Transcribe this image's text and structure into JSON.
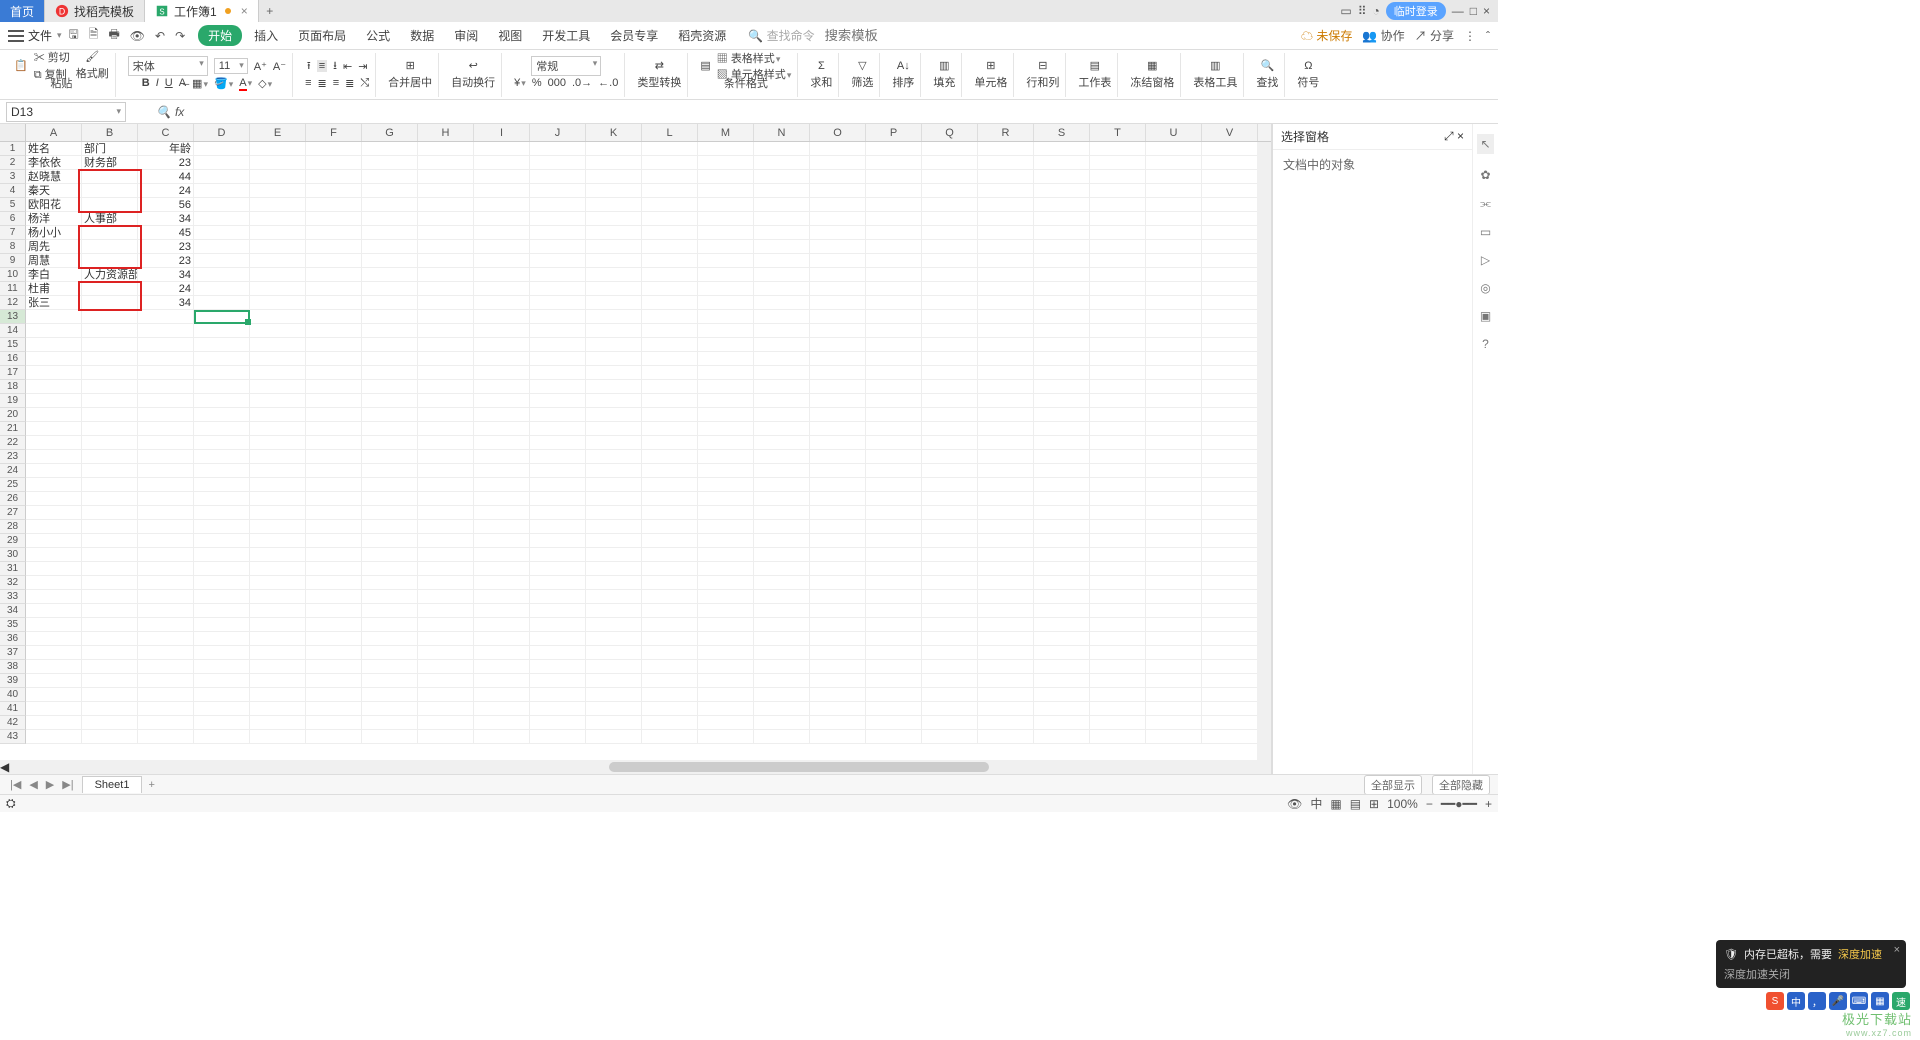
{
  "tabs": {
    "home": "首页",
    "template": "找稻壳模板",
    "workbook": "工作簿1"
  },
  "window": {
    "login": "临时登录"
  },
  "menu": {
    "file": "文件",
    "start": "开始",
    "items": [
      "插入",
      "页面布局",
      "公式",
      "数据",
      "审阅",
      "视图",
      "开发工具",
      "会员专享",
      "稻壳资源"
    ],
    "search_cmd": "查找命令",
    "search_tmpl": "搜索模板",
    "unsaved": "未保存",
    "coop": "协作",
    "share": "分享"
  },
  "ribbon": {
    "paste": "粘贴",
    "cut": "剪切",
    "copy": "复制",
    "format_painter": "格式刷",
    "font_name": "宋体",
    "font_size": "11",
    "merge": "合并居中",
    "wrap": "自动换行",
    "number_format": "常规",
    "type_convert": "类型转换",
    "cond_format": "条件格式",
    "table_style": "表格样式",
    "cell_style": "单元格样式",
    "sum": "求和",
    "filter": "筛选",
    "sort": "排序",
    "fill": "填充",
    "cell": "单元格",
    "rowcol": "行和列",
    "worksheet": "工作表",
    "freeze": "冻结窗格",
    "table_tools": "表格工具",
    "find": "查找",
    "symbol": "符号"
  },
  "namebox": "D13",
  "fx": "fx",
  "columns": [
    "A",
    "B",
    "C",
    "D",
    "E",
    "F",
    "G",
    "H",
    "I",
    "J",
    "K",
    "L",
    "M",
    "N",
    "O",
    "P",
    "Q",
    "R",
    "S",
    "T",
    "U",
    "V"
  ],
  "row_count": 43,
  "selected_row": 13,
  "data_rows": [
    {
      "A": "姓名",
      "B": "部门",
      "C": "年龄"
    },
    {
      "A": "李依依",
      "B": "财务部",
      "C": "23"
    },
    {
      "A": "赵晓慧",
      "B": "",
      "C": "44"
    },
    {
      "A": "秦天",
      "B": "",
      "C": "24"
    },
    {
      "A": "欧阳花",
      "B": "",
      "C": "56"
    },
    {
      "A": "杨洋",
      "B": "人事部",
      "C": "34"
    },
    {
      "A": "杨小小",
      "B": "",
      "C": "45"
    },
    {
      "A": "周先",
      "B": "",
      "C": "23"
    },
    {
      "A": "周慧",
      "B": "",
      "C": "23"
    },
    {
      "A": "李白",
      "B": "人力资源部",
      "C": "34"
    },
    {
      "A": "杜甫",
      "B": "",
      "C": "24"
    },
    {
      "A": "张三",
      "B": "",
      "C": "34"
    }
  ],
  "panel": {
    "title": "选择窗格",
    "subtitle": "文档中的对象"
  },
  "sheet": {
    "name": "Sheet1",
    "show_all": "全部显示",
    "hide_all": "全部隐藏"
  },
  "status": {
    "zoom": "100%"
  },
  "toast": {
    "line1": "内存已超标，需要",
    "accel": "深度加速",
    "line2": "深度加速关闭"
  },
  "watermark": {
    "main": "极光下载站",
    "sub": "www.xz7.com"
  }
}
